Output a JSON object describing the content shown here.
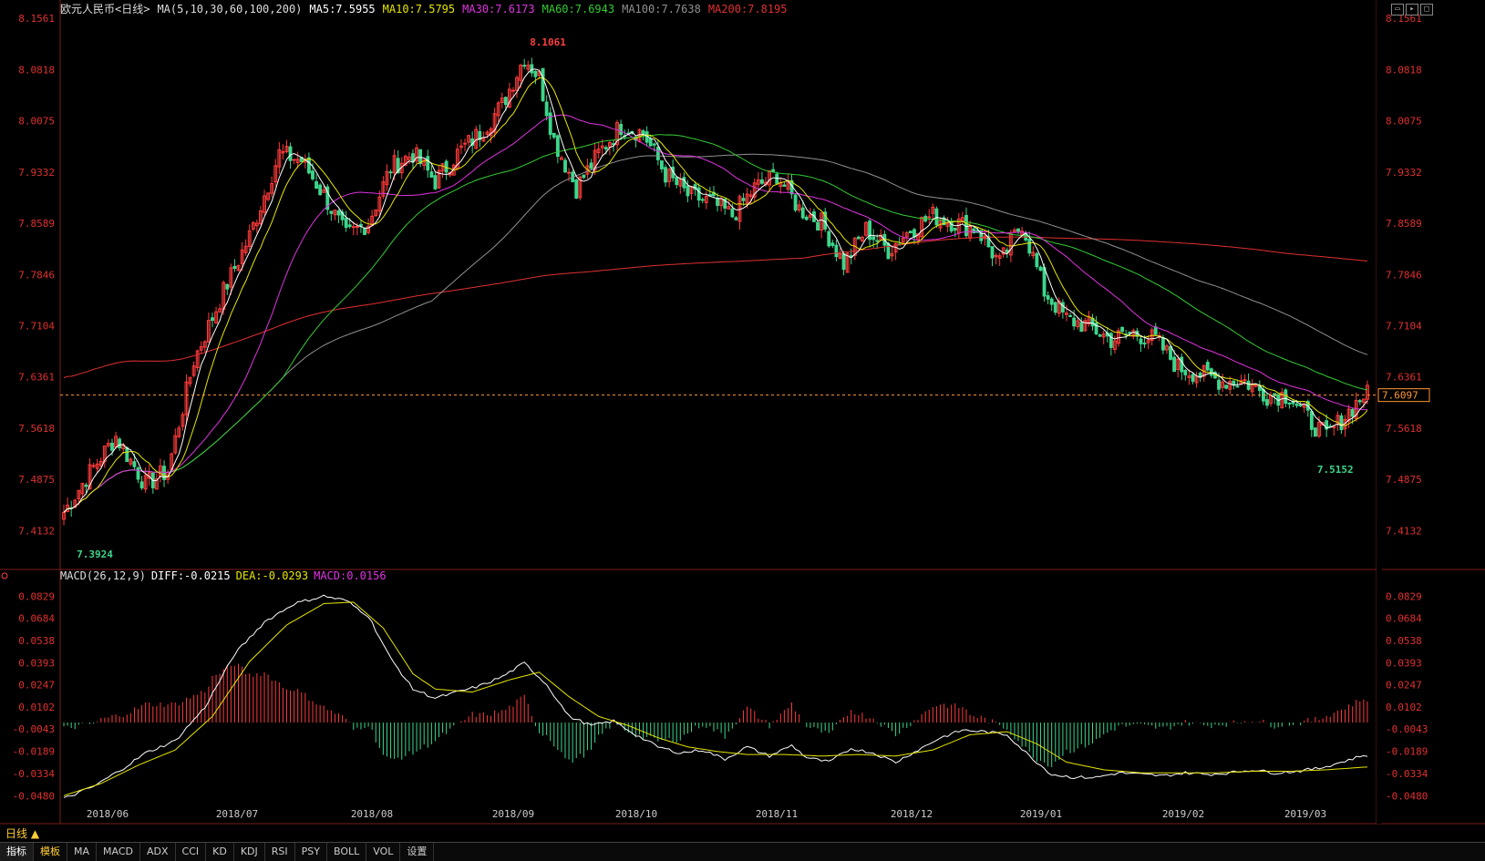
{
  "header": {
    "title": "欧元人民币<日线>",
    "ma_label": "MA(5,10,30,60,100,200)",
    "ma5": "MA5:7.5955",
    "ma10": "MA10:7.5795",
    "ma30": "MA30:7.6173",
    "ma60": "MA60:7.6943",
    "ma100": "MA100:7.7638",
    "ma200": "MA200:7.8195"
  },
  "macd_header": {
    "label": "MACD(26,12,9)",
    "diff": "DIFF:-0.0215",
    "dea": "DEA:-0.0293",
    "macd": "MACD:0.0156"
  },
  "annotations": {
    "high": "8.1061",
    "low": "7.3924",
    "low2": "7.5152",
    "last_price": "7.6097"
  },
  "period_button": "日线 ▲",
  "toolbar": [
    "指标",
    "模板",
    "MA",
    "MACD",
    "ADX",
    "CCI",
    "KD",
    "KDJ",
    "RSI",
    "PSY",
    "BOLL",
    "VOL",
    "设置"
  ],
  "colors": {
    "up": "#ff3b3b",
    "down": "#3dd68c",
    "ma5": "#ffffff",
    "ma10": "#e6e600",
    "ma30": "#e033e0",
    "ma60": "#33cc33",
    "ma100": "#909090",
    "ma200": "#e03030",
    "axis_text": "#e03030",
    "macd_axis_text": "#e03030",
    "dotline": "#ff9933"
  },
  "chart_data": [
    {
      "type": "candlestick",
      "title": "欧元人民币<日线>",
      "x_ticks": [
        "2018/06",
        "2018/07",
        "2018/08",
        "2018/09",
        "2018/10",
        "2018/11",
        "2018/12",
        "2019/01",
        "2019/02",
        "2019/03"
      ],
      "y_ticks": [
        "8.1561",
        "8.0818",
        "8.0075",
        "7.9332",
        "7.8589",
        "7.7846",
        "7.7104",
        "7.6361",
        "7.5618",
        "7.4875",
        "7.4132"
      ],
      "ylim": [
        7.39,
        8.1561
      ],
      "close_anchors": [
        [
          0,
          7.44
        ],
        [
          6,
          7.49
        ],
        [
          14,
          7.55
        ],
        [
          22,
          7.48
        ],
        [
          28,
          7.5
        ],
        [
          35,
          7.66
        ],
        [
          43,
          7.76
        ],
        [
          50,
          7.84
        ],
        [
          58,
          7.96
        ],
        [
          64,
          7.95
        ],
        [
          70,
          7.9
        ],
        [
          76,
          7.84
        ],
        [
          82,
          7.86
        ],
        [
          88,
          7.94
        ],
        [
          94,
          7.96
        ],
        [
          100,
          7.92
        ],
        [
          106,
          7.96
        ],
        [
          112,
          7.99
        ],
        [
          118,
          8.03
        ],
        [
          124,
          8.1
        ],
        [
          128,
          8.07
        ],
        [
          132,
          7.98
        ],
        [
          138,
          7.91
        ],
        [
          144,
          7.96
        ],
        [
          150,
          8.0
        ],
        [
          156,
          7.99
        ],
        [
          162,
          7.93
        ],
        [
          168,
          7.9
        ],
        [
          174,
          7.89
        ],
        [
          180,
          7.87
        ],
        [
          186,
          7.91
        ],
        [
          192,
          7.93
        ],
        [
          198,
          7.88
        ],
        [
          204,
          7.86
        ],
        [
          210,
          7.8
        ],
        [
          216,
          7.85
        ],
        [
          222,
          7.82
        ],
        [
          228,
          7.85
        ],
        [
          234,
          7.87
        ],
        [
          240,
          7.86
        ],
        [
          246,
          7.85
        ],
        [
          252,
          7.8
        ],
        [
          258,
          7.86
        ],
        [
          264,
          7.76
        ],
        [
          270,
          7.72
        ],
        [
          276,
          7.71
        ],
        [
          282,
          7.69
        ],
        [
          288,
          7.7
        ],
        [
          294,
          7.69
        ],
        [
          300,
          7.65
        ],
        [
          306,
          7.64
        ],
        [
          312,
          7.63
        ],
        [
          318,
          7.63
        ],
        [
          324,
          7.61
        ],
        [
          330,
          7.61
        ],
        [
          336,
          7.57
        ],
        [
          340,
          7.55
        ],
        [
          345,
          7.58
        ],
        [
          350,
          7.61
        ]
      ],
      "series": [
        {
          "name": "MA5",
          "last": 7.5955
        },
        {
          "name": "MA10",
          "last": 7.5795
        },
        {
          "name": "MA30",
          "last": 7.6173
        },
        {
          "name": "MA60",
          "last": 7.6943
        },
        {
          "name": "MA100",
          "last": 7.7638
        },
        {
          "name": "MA200",
          "last": 7.8195
        }
      ],
      "max_label": "8.1061",
      "min_label": "7.3924",
      "recent_low_label": "7.5152",
      "last_price": 7.6097
    },
    {
      "type": "bar",
      "title": "MACD(26,12,9)",
      "y_ticks": [
        "0.0829",
        "0.0684",
        "0.0538",
        "0.0393",
        "0.0247",
        "0.0102",
        "-0.0043",
        "-0.0189",
        "-0.0334",
        "-0.0480"
      ],
      "ylim": [
        -0.052,
        0.0855
      ],
      "diff_anchors": [
        [
          0,
          -0.05
        ],
        [
          8,
          -0.042
        ],
        [
          16,
          -0.03
        ],
        [
          22,
          -0.02
        ],
        [
          30,
          -0.012
        ],
        [
          38,
          0.01
        ],
        [
          46,
          0.045
        ],
        [
          54,
          0.066
        ],
        [
          62,
          0.078
        ],
        [
          70,
          0.083
        ],
        [
          76,
          0.08
        ],
        [
          82,
          0.07
        ],
        [
          88,
          0.042
        ],
        [
          94,
          0.022
        ],
        [
          100,
          0.016
        ],
        [
          106,
          0.02
        ],
        [
          112,
          0.024
        ],
        [
          118,
          0.03
        ],
        [
          124,
          0.039
        ],
        [
          130,
          0.025
        ],
        [
          136,
          0.004
        ],
        [
          142,
          -0.002
        ],
        [
          148,
          0.001
        ],
        [
          154,
          -0.008
        ],
        [
          160,
          -0.016
        ],
        [
          166,
          -0.02
        ],
        [
          172,
          -0.018
        ],
        [
          178,
          -0.024
        ],
        [
          184,
          -0.016
        ],
        [
          190,
          -0.022
        ],
        [
          196,
          -0.015
        ],
        [
          200,
          -0.023
        ],
        [
          206,
          -0.026
        ],
        [
          212,
          -0.017
        ],
        [
          218,
          -0.02
        ],
        [
          224,
          -0.026
        ],
        [
          230,
          -0.018
        ],
        [
          236,
          -0.01
        ],
        [
          242,
          -0.005
        ],
        [
          248,
          -0.006
        ],
        [
          254,
          -0.008
        ],
        [
          260,
          -0.022
        ],
        [
          266,
          -0.034
        ],
        [
          272,
          -0.036
        ],
        [
          278,
          -0.036
        ],
        [
          284,
          -0.033
        ],
        [
          290,
          -0.034
        ],
        [
          296,
          -0.035
        ],
        [
          302,
          -0.033
        ],
        [
          308,
          -0.034
        ],
        [
          314,
          -0.033
        ],
        [
          320,
          -0.031
        ],
        [
          326,
          -0.033
        ],
        [
          332,
          -0.032
        ],
        [
          338,
          -0.03
        ],
        [
          344,
          -0.026
        ],
        [
          350,
          -0.0215
        ]
      ],
      "dea_anchors": [
        [
          0,
          -0.048
        ],
        [
          10,
          -0.04
        ],
        [
          20,
          -0.028
        ],
        [
          30,
          -0.018
        ],
        [
          40,
          0.004
        ],
        [
          50,
          0.04
        ],
        [
          60,
          0.064
        ],
        [
          70,
          0.078
        ],
        [
          78,
          0.079
        ],
        [
          86,
          0.062
        ],
        [
          94,
          0.032
        ],
        [
          100,
          0.022
        ],
        [
          110,
          0.02
        ],
        [
          120,
          0.028
        ],
        [
          128,
          0.033
        ],
        [
          136,
          0.017
        ],
        [
          144,
          0.004
        ],
        [
          152,
          -0.002
        ],
        [
          160,
          -0.01
        ],
        [
          168,
          -0.016
        ],
        [
          176,
          -0.019
        ],
        [
          184,
          -0.021
        ],
        [
          194,
          -0.021
        ],
        [
          204,
          -0.022
        ],
        [
          214,
          -0.021
        ],
        [
          224,
          -0.022
        ],
        [
          234,
          -0.018
        ],
        [
          244,
          -0.008
        ],
        [
          254,
          -0.006
        ],
        [
          262,
          -0.014
        ],
        [
          270,
          -0.026
        ],
        [
          280,
          -0.031
        ],
        [
          290,
          -0.033
        ],
        [
          300,
          -0.033
        ],
        [
          310,
          -0.033
        ],
        [
          320,
          -0.032
        ],
        [
          330,
          -0.032
        ],
        [
          340,
          -0.031
        ],
        [
          350,
          -0.0293
        ]
      ],
      "series": [
        {
          "name": "DIFF",
          "last": -0.0215
        },
        {
          "name": "DEA",
          "last": -0.0293
        },
        {
          "name": "MACD",
          "last": 0.0156
        }
      ]
    }
  ]
}
